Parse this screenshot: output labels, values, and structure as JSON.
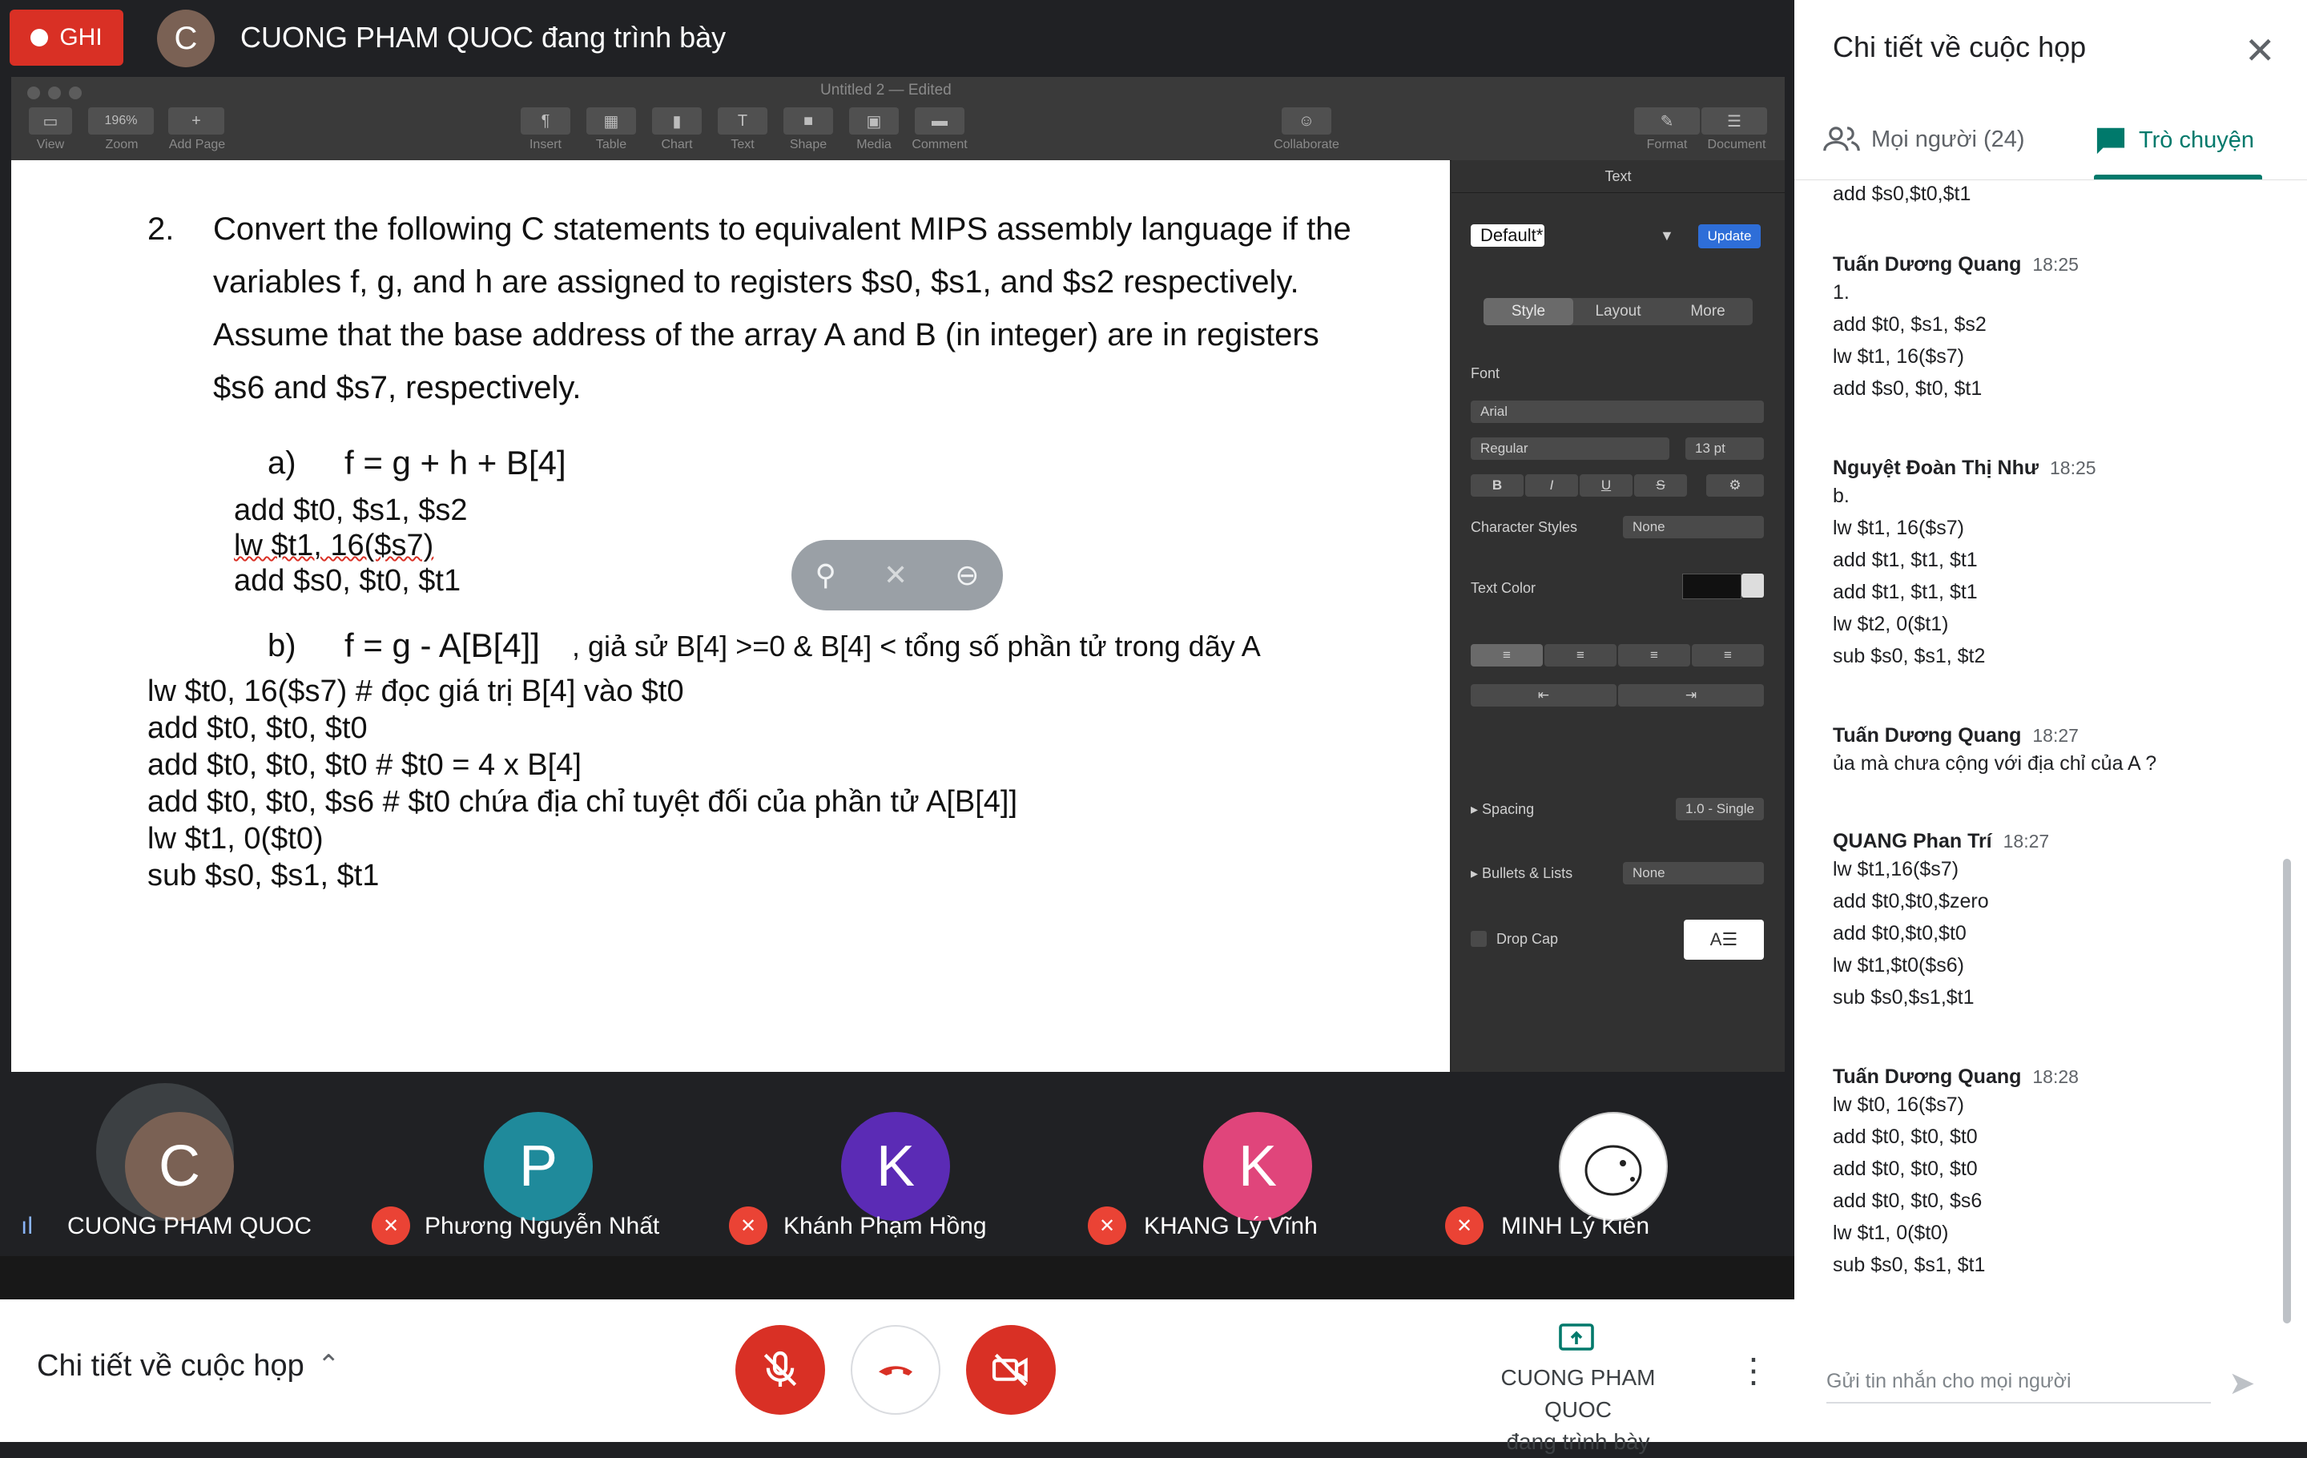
{
  "meet": {
    "record_label": "GHI",
    "presenter_initial": "C",
    "presenting_text": "CUONG PHAM QUOC đang trình bày"
  },
  "pages_app": {
    "doc_title": "Untitled 2 — Edited",
    "zoom": "196%",
    "toolbar_labels": [
      "View",
      "Zoom",
      "Add Page",
      "Insert",
      "Table",
      "Chart",
      "Text",
      "Shape",
      "Media",
      "Comment",
      "Collaborate",
      "Format",
      "Document"
    ]
  },
  "document": {
    "q_num": "2.",
    "q_lines": [
      "Convert the following C statements to equivalent MIPS assembly language if the",
      "variables f, g, and h are assigned to registers $s0, $s1, and $s2 respectively.",
      "Assume that the base address of the array A and B (in integer) are in registers",
      "$s6 and $s7, respectively."
    ],
    "a_label": "a)",
    "a_stmt": "f = g + h + B[4]",
    "a_code": [
      "add $t0, $s1, $s2",
      "lw $t1, 16($s7)",
      "add $s0, $t0, $t1"
    ],
    "b_label": "b)",
    "b_stmt": "f = g - A[B[4]]",
    "b_note": ", giả sử B[4] >=0 & B[4] < tổng số phần tử trong dãy A",
    "b_code": [
      "lw $t0, 16($s7) # đọc giá trị B[4] vào $t0",
      "add $t0, $t0, $t0",
      "add $t0, $t0, $t0 # $t0 = 4 x B[4]",
      "add $t0, $t0, $s6 # $t0 chứa địa chỉ tuyệt đối của phần tử A[B[4]]",
      "lw $t1, 0($t0)",
      "sub $s0, $s1, $t1"
    ]
  },
  "inspector": {
    "header": "Text",
    "style_name": "Default*",
    "update_label": "Update",
    "tabs": [
      "Style",
      "Layout",
      "More"
    ],
    "font_label": "Font",
    "font_name": "Arial",
    "font_style": "Regular",
    "font_size": "13 pt",
    "format_buttons": [
      "B",
      "I",
      "U",
      "S"
    ],
    "char_styles_label": "Character Styles",
    "char_styles_value": "None",
    "text_color_label": "Text Color",
    "spacing_label": "Spacing",
    "spacing_value": "1.0 - Single",
    "bullets_label": "Bullets & Lists",
    "bullets_value": "None",
    "dropcap_label": "Drop Cap"
  },
  "participants": [
    {
      "initial": "C",
      "name": "CUONG PHAM QUOC",
      "color": "#7a6154",
      "speaking": true
    },
    {
      "initial": "P",
      "name": "Phương Nguyễn Nhất",
      "color": "#1f8a9b",
      "speaking": false
    },
    {
      "initial": "K",
      "name": "Khánh Phạm Hồng",
      "color": "#5b2bb5",
      "speaking": false
    },
    {
      "initial": "K",
      "name": "KHANG Lý Vĩnh",
      "color": "#e0457b",
      "speaking": false
    },
    {
      "initial": "",
      "name": "MINH Lý Kiên",
      "color": "#ffffff",
      "speaking": false
    }
  ],
  "bottombar": {
    "details_label": "Chi tiết về cuộc họp",
    "present_label_1": "CUONG PHAM QUOC",
    "present_label_2": "đang trình bày"
  },
  "panel": {
    "title": "Chi tiết về cuộc họp",
    "tab_people": "Mọi người (24)",
    "tab_chat": "Trò chuyện",
    "top_fragment": "add $s0,$t0,$t1",
    "messages": [
      {
        "sender": "Tuấn Dương Quang",
        "time": "18:25",
        "lines": [
          "1.",
          "add $t0, $s1, $s2",
          "lw $t1, 16($s7)",
          "add $s0, $t0, $t1"
        ]
      },
      {
        "sender": "Nguyệt Đoàn Thị Như",
        "time": "18:25",
        "lines": [
          "b.",
          "lw $t1, 16($s7)",
          "add $t1, $t1, $t1",
          "add $t1, $t1, $t1",
          "lw $t2, 0($t1)",
          "sub $s0, $s1, $t2"
        ]
      },
      {
        "sender": "Tuấn Dương Quang",
        "time": "18:27",
        "lines": [
          "ủa mà chưa cộng với địa chỉ của A ?"
        ]
      },
      {
        "sender": "QUANG Phan Trí",
        "time": "18:27",
        "lines": [
          "lw $t1,16($s7)",
          "add $t0,$t0,$zero",
          "add $t0,$t0,$t0",
          "lw $t1,$t0($s6)",
          "sub $s0,$s1,$t1"
        ]
      },
      {
        "sender": "Tuấn Dương Quang",
        "time": "18:28",
        "lines": [
          "lw $t0, 16($s7)",
          "add $t0, $t0, $t0",
          "add $t0, $t0, $t0",
          "add $t0, $t0, $s6",
          "lw $t1, 0($t0)",
          "sub $s0, $s1, $t1"
        ]
      }
    ],
    "input_placeholder": "Gửi tin nhắn cho mọi người"
  }
}
